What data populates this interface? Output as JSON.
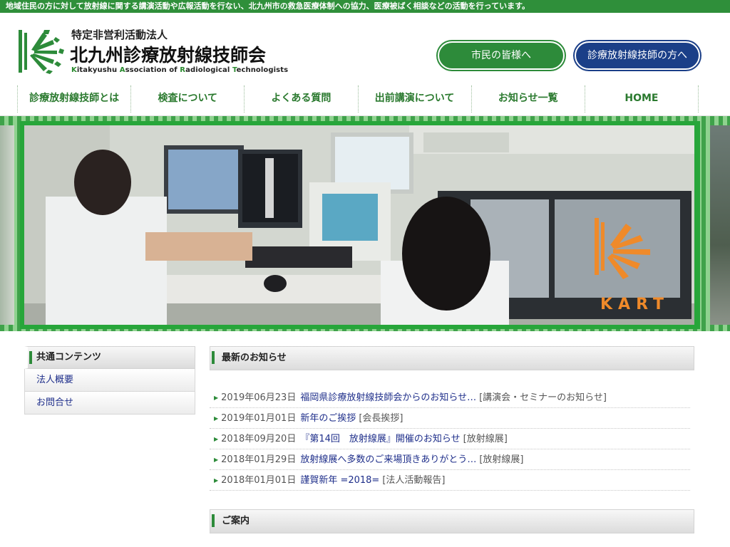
{
  "topbar": {
    "text": "地域住民の方に対して放射線に関する講演活動や広報活動を行ない、北九州市の救急医療体制への協力、医療被ばく相談などの活動を行っています。"
  },
  "header": {
    "org_type": "特定非営利活動法人",
    "org_name": "北九州診療放射線技師会",
    "org_en_parts": [
      "K",
      "itakyushu ",
      "A",
      "ssociation of ",
      "R",
      "adiological ",
      "T",
      "echnologists"
    ],
    "buttons": {
      "citizen": "市民の皆様へ",
      "tech": "診療放射線技師の方へ"
    }
  },
  "nav": {
    "items": [
      "診療放射線技師とは",
      "検査について",
      "よくある質問",
      "出前講演について",
      "お知らせ一覧",
      "HOME"
    ]
  },
  "hero": {
    "logo_text": "KART"
  },
  "sidebar": {
    "heading": "共通コンテンツ",
    "items": [
      "法人概要",
      "お問合せ"
    ]
  },
  "main": {
    "news_heading": "最新のお知らせ",
    "news": [
      {
        "date": "2019年06月23日",
        "title": "福岡県診療放射線技師会からのお知らせ…",
        "category": "[講演会・セミナーのお知らせ]"
      },
      {
        "date": "2019年01月01日",
        "title": "新年のご挨拶",
        "category": "[会長挨拶]"
      },
      {
        "date": "2018年09月20日",
        "title": "『第14回　放射線展』開催のお知らせ",
        "category": "[放射線展]"
      },
      {
        "date": "2018年01月29日",
        "title": "放射線展へ多数のご来場頂きありがとう…",
        "category": "[放射線展]"
      },
      {
        "date": "2018年01月01日",
        "title": "謹賀新年 =2018=",
        "category": "[法人活動報告]"
      }
    ],
    "guide_heading": "ご案内"
  },
  "colors": {
    "brand_green": "#2d8b3a",
    "brand_navy": "#1b3f88",
    "link": "#1e2e8a"
  },
  "icons": {
    "logo": "kart-logo-icon",
    "bullet": "triangle-right-icon"
  }
}
